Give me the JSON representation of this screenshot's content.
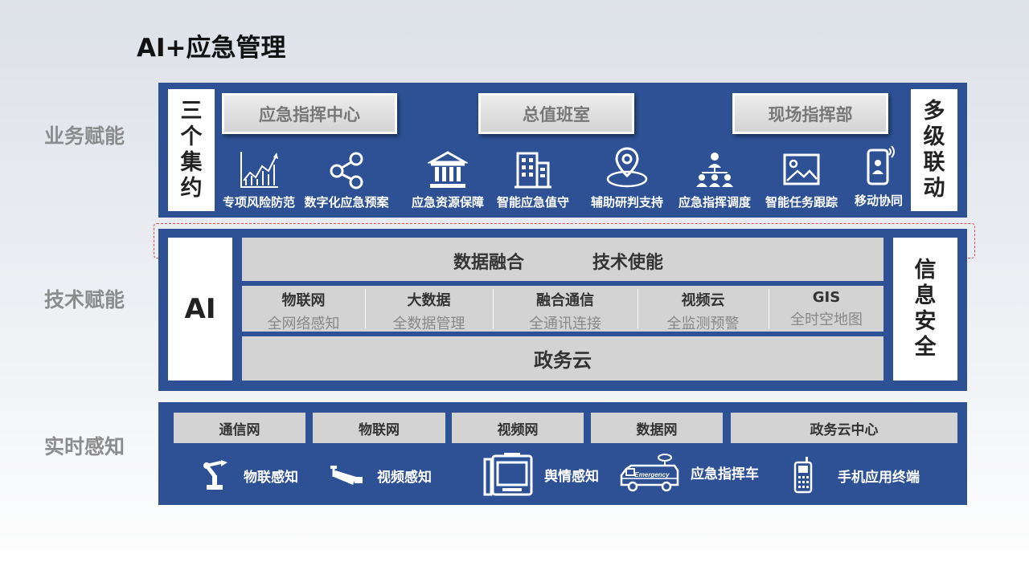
{
  "title": "AI+应急管理",
  "side_labels": {
    "business": "业务赋能",
    "tech": "技术赋能",
    "realtime": "实时感知"
  },
  "business": {
    "left_box": "三个集约",
    "right_box": "多级联动",
    "buttons": [
      "应急指挥中心",
      "总值班室",
      "现场指挥部"
    ],
    "items": [
      {
        "label": "专项风险防范",
        "icon": "chart-icon"
      },
      {
        "label": "数字化应急预案",
        "icon": "share-icon"
      },
      {
        "label": "应急资源保障",
        "icon": "bank-icon"
      },
      {
        "label": "智能应急值守",
        "icon": "building-icon"
      },
      {
        "label": "辅助研判支持",
        "icon": "location-icon"
      },
      {
        "label": "应急指挥调度",
        "icon": "org-icon"
      },
      {
        "label": "智能任务跟踪",
        "icon": "image-icon"
      },
      {
        "label": "移动协同",
        "icon": "phone-icon"
      }
    ]
  },
  "tech": {
    "left_box": "AI",
    "right_box": "信息安全",
    "top_bar": {
      "left": "数据融合",
      "right": "技术使能"
    },
    "cells": [
      {
        "title": "物联网",
        "subtitle": "全网络感知"
      },
      {
        "title": "大数据",
        "subtitle": "全数据管理"
      },
      {
        "title": "融合通信",
        "subtitle": "全通讯连接"
      },
      {
        "title": "视频云",
        "subtitle": "全监测预警"
      },
      {
        "title": "GIS",
        "subtitle": "全时空地图"
      }
    ],
    "bottom_bar": "政务云"
  },
  "realtime": {
    "networks": [
      "通信网",
      "物联网",
      "视频网",
      "数据网",
      "政务云中心"
    ],
    "sensing": [
      {
        "label": "物联感知",
        "icon": "robot-arm-icon"
      },
      {
        "label": "视频感知",
        "icon": "camera-icon"
      },
      {
        "label": "舆情感知",
        "icon": "kiosk-icon"
      },
      {
        "label": "应急指挥车",
        "icon": "vehicle-icon",
        "vehicle_text": "Emergency"
      },
      {
        "label": "手机应用终端",
        "icon": "mobile-icon"
      }
    ]
  }
}
